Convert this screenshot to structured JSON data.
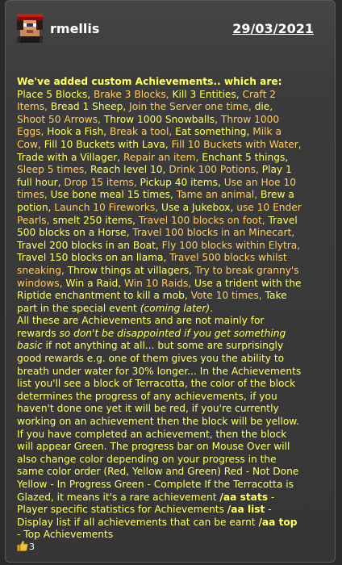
{
  "post": {
    "author": "rmellis",
    "date": "29/03/2021",
    "heading": "We've added custom Achievements.. which are:",
    "achievements_text": [
      "Place 5 Blocks, ",
      "Brake 3 Blocks, ",
      "Kill 3 Entities, ",
      "Craft 2 Items, ",
      "Bread 1 Sheep, ",
      "Join the Server one time, ",
      "die, ",
      "Shoot 50 Arrows, ",
      "Throw 1000 Snowballs, ",
      "Throw 1000 Eggs, ",
      "Hook a Fish, ",
      "Break a tool, ",
      "Eat something, ",
      "Milk a Cow, ",
      "Fill 10 Buckets with Lava, ",
      "Fill 10 Buckets with Water, ",
      "Trade with a Villager, ",
      "Repair an item, ",
      "Enchant 5 things, ",
      "Sleep 5 times, ",
      "Reach level 10, ",
      "Drink 100 Potions, ",
      "Play 1 full hour, ",
      "Drop 15 items, ",
      "Pickup 40 items, ",
      "Use an Hoe 10 times, ",
      "Use bone meal 15 times, ",
      "Tame an animal, ",
      "Brew a potion, ",
      "Launch 10 Fireworks, ",
      "Use a Jukebox, ",
      "use 10 Ender Pearls, ",
      "smelt 250 items, ",
      "Travel 100 blocks on foot, ",
      "Travel 500 blocks on a Horse, ",
      "Travel 100 blocks in an Minecart, ",
      "Travel 200 blocks in an Boat, ",
      "Fly 100 blocks within Elytra, ",
      "Travel 150 blocks on an llama, ",
      "Travel 500 blocks whilst sneaking, ",
      "Throw things at villagers, ",
      "Try to break granny's windows, ",
      "Win a Raid, ",
      "Win 10 Raids, ",
      "Use a trident with the Riptide enchantment to kill a mob, ",
      "Vote 10 times, ",
      "Take part in the special event "
    ],
    "coming_later": "(coming later)",
    "period": ".",
    "para2_a": "All these are Achievements and are not mainly for rewards ",
    "para2_em": "so don't be disappointed if you get something basic",
    "para2_b": " if not anything at all... but some are surprisingly good rewards e.g. one of them gives you the ability to breath under water for 30% longer... In the Achievements list you'll see a block of Terracotta, the color of the block determines the progress of any achievements, if you haven't done one yet it will be red, if you're currently working on an achievement then the block will be yellow. If you have completed an achievement, then the block will appear Green. The progress bar on Mouse Over will also change color depending on your progress in the same color order (Red, Yellow and Green) Red - Not Done Yellow - In Progress Green - Complete If the Terracotta is Glazed, it means it's a rare achievement ",
    "cmd_stats": "/aa stats",
    "cmd_stats_desc": " - Player specific statistics for Achievements ",
    "cmd_list": "/aa list",
    "cmd_list_desc": " - Display list if all achievements that can be earnt ",
    "cmd_top": "/aa top",
    "cmd_top_desc": " - Top Achievements",
    "likes": "3"
  },
  "icons": {
    "avatar": "pixel-avatar-icon",
    "like": "thumbs-up-icon"
  },
  "colors": {
    "text": "#ffff66",
    "highlight": "#ffcc66",
    "background": "#3b3b3b",
    "border": "#5a5a5a"
  }
}
